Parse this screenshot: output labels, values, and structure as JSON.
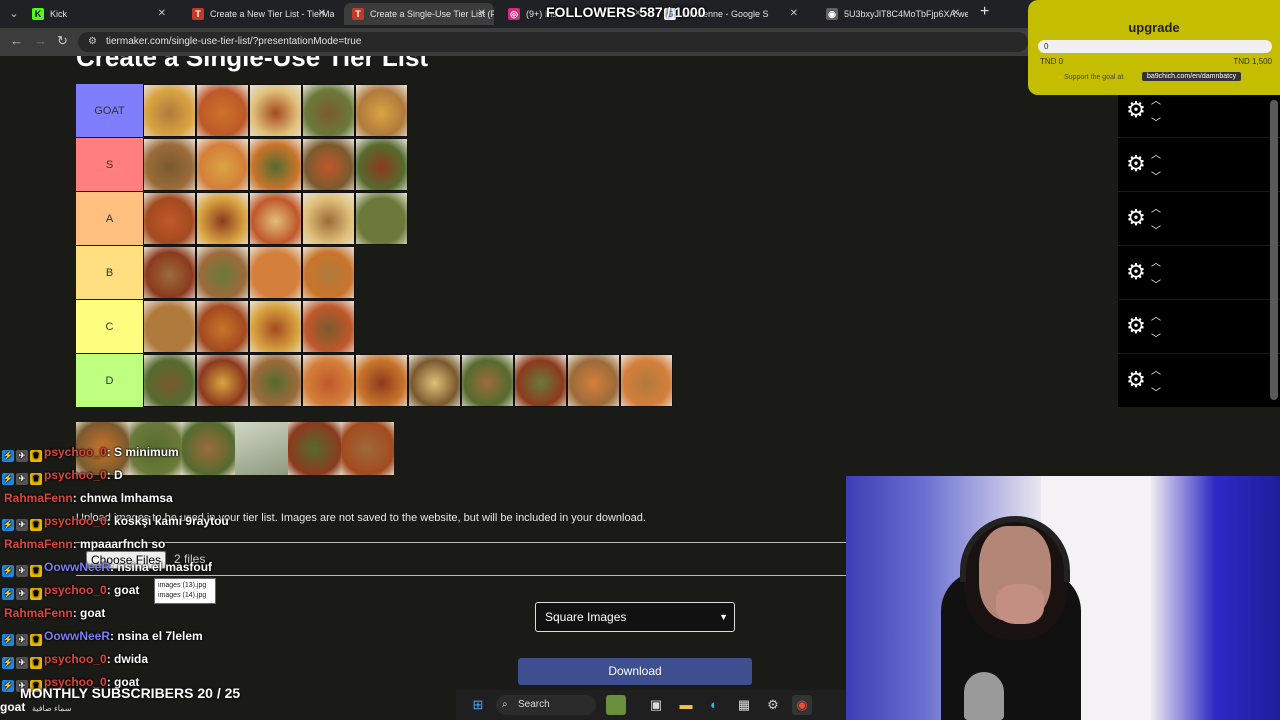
{
  "browser": {
    "tabs": [
      {
        "label": "Kick",
        "fav_bg": "#53fc18",
        "fav_text": "K"
      },
      {
        "label": "Create a New Tier List - TierMa",
        "fav_bg": "#c0392b",
        "fav_text": "T"
      },
      {
        "label": "Create a Single-Use Tier List (P",
        "fav_bg": "#c0392b",
        "fav_text": "T"
      },
      {
        "label": "(9+) Ins",
        "fav_bg": "#d62976",
        "fav_text": "◎"
      },
      {
        "label": "tunisienne - Google S",
        "fav_bg": "#ffffff",
        "fav_text": "G"
      },
      {
        "label": "5U3bxyJlT8C4MoTbFjp6XA.we",
        "fav_bg": "#5f6368",
        "fav_text": "◉"
      }
    ],
    "url": "tiermaker.com/single-use-tier-list/?presentationMode=true"
  },
  "page": {
    "heading": "Create a Single-Use Tier List",
    "tiers": [
      {
        "label": "GOAT",
        "color": "#7f7ffe",
        "images": 5
      },
      {
        "label": "S",
        "color": "#ff7f7f",
        "images": 5
      },
      {
        "label": "A",
        "color": "#ffbf7f",
        "images": 5
      },
      {
        "label": "B",
        "color": "#ffdf7f",
        "images": 4
      },
      {
        "label": "C",
        "color": "#ffff7f",
        "images": 4
      },
      {
        "label": "D",
        "color": "#bfff7f",
        "images": 10
      }
    ],
    "pool_images": 6,
    "upload_text": "Upload images to be used in your tier list. Images are not saved to the website, but will be included in your download.",
    "upload_text_bold": "your tier list",
    "choose_files": "Choose Files",
    "files_count": "2 files",
    "tooltip": [
      "images (13).jpg",
      "images (14).jpg"
    ],
    "select_value": "Square Images",
    "download_label": "Download"
  },
  "overlay": {
    "followers": "FOLLOWERS 587 / 1000",
    "goal_title": "upgrade",
    "goal_value": "0",
    "goal_min": "TND 0",
    "goal_max": "TND 1,500",
    "goal_support": "Support the goal at",
    "goal_link": "ba9chich.com/en/damnbatcy",
    "subscribers": "MONTHLY SUBSCRIBERS 20 / 25",
    "bottom_user": "goat",
    "bottom_caption": "سماء صافية"
  },
  "chat": [
    {
      "user": "psychoo_0",
      "color": "#e0453a",
      "text": ": S minimum",
      "badges": true
    },
    {
      "user": "psychoo_0",
      "color": "#e0453a",
      "text": ": D",
      "badges": true
    },
    {
      "user": "RahmaFenn",
      "color": "#e0453a",
      "text": ": chnwa lmhamsa",
      "badges": false
    },
    {
      "user": "psychoo_0",
      "color": "#e0453a",
      "text": ": koskşi kami 9raytou",
      "badges": true
    },
    {
      "user": "RahmaFenn",
      "color": "#e0453a",
      "text": ": mpaaarfnch so",
      "badges": false
    },
    {
      "user": "OowwNeeR",
      "color": "#7c7cf5",
      "text": ": nsina el masfouf",
      "badges": true
    },
    {
      "user": "psychoo_0",
      "color": "#e0453a",
      "text": ": goat",
      "badges": true
    },
    {
      "user": "RahmaFenn",
      "color": "#e0453a",
      "text": ": goat",
      "badges": false
    },
    {
      "user": "OowwNeeR",
      "color": "#7c7cf5",
      "text": ": nsina el 7lelem",
      "badges": true
    },
    {
      "user": "psychoo_0",
      "color": "#e0453a",
      "text": ": dwida",
      "badges": true
    },
    {
      "user": "psychoo_0",
      "color": "#e0453a",
      "text": ": goat",
      "badges": true
    }
  ],
  "taskbar": {
    "search": "Search"
  }
}
